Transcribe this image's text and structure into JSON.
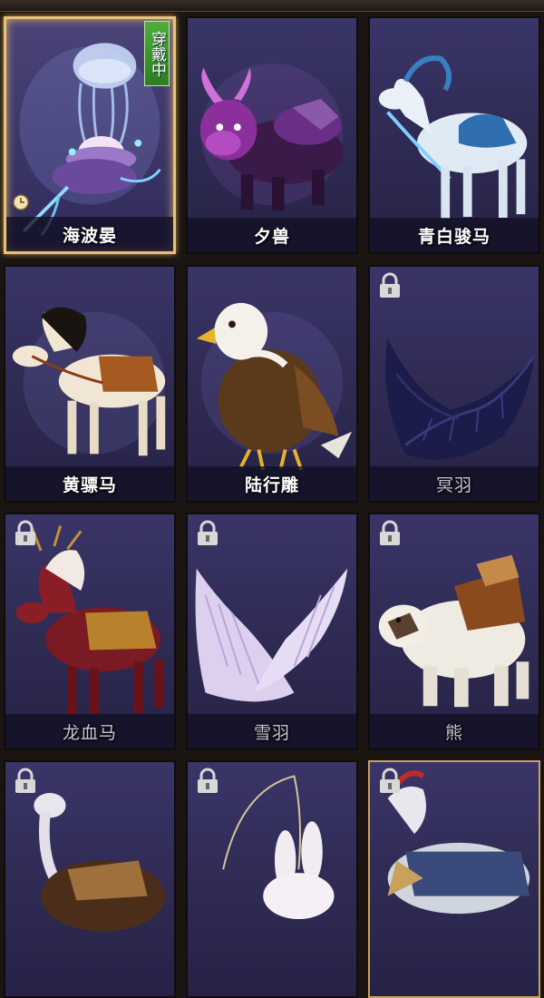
{
  "mounts": [
    {
      "name": "海波晏",
      "status": "穿戴中",
      "locked": false,
      "selected": true,
      "art": "jellyfish-mount-art"
    },
    {
      "name": "夕兽",
      "locked": false,
      "selected": false,
      "art": "nian-beast-mount-art"
    },
    {
      "name": "青白骏马",
      "locked": false,
      "selected": false,
      "art": "blue-white-horse-art"
    },
    {
      "name": "黄骠马",
      "locked": false,
      "selected": false,
      "art": "yellow-horse-art"
    },
    {
      "name": "陆行雕",
      "locked": false,
      "selected": false,
      "art": "eagle-mount-art"
    },
    {
      "name": "冥羽",
      "locked": true,
      "selected": false,
      "art": "dark-wings-art"
    },
    {
      "name": "龙血马",
      "locked": true,
      "selected": false,
      "art": "dragon-blood-horse-art"
    },
    {
      "name": "雪羽",
      "locked": true,
      "selected": false,
      "art": "snow-wings-art"
    },
    {
      "name": "熊",
      "locked": true,
      "selected": false,
      "art": "bear-mount-art"
    },
    {
      "name": "",
      "locked": true,
      "selected": false,
      "art": "ostrich-mount-art"
    },
    {
      "name": "",
      "locked": true,
      "selected": false,
      "art": "rabbit-mount-art"
    },
    {
      "name": "",
      "locked": true,
      "selected": false,
      "art": "armored-horse-art"
    }
  ],
  "colors": {
    "selected_border": "#e6c27a",
    "wear_badge": "#3f9a30",
    "card_bg": "#2e2a52"
  }
}
